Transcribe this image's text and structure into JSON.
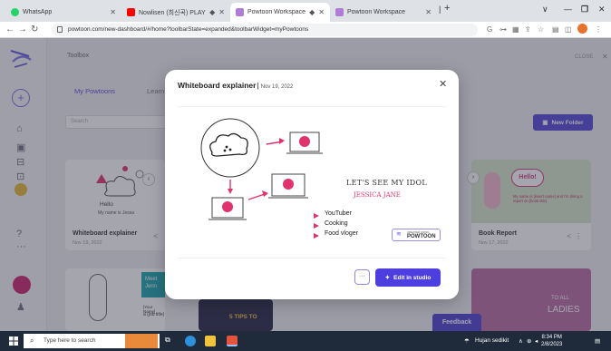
{
  "browser": {
    "tabs": [
      {
        "label": "WhatsApp",
        "icon": "whatsapp-icon",
        "color": "#25d366"
      },
      {
        "label": "Nowlisen (최신곡) PLAYLIST",
        "icon": "youtube-icon",
        "color": "#ff0000"
      },
      {
        "label": "Powtoon Workspace",
        "icon": "powtoon-icon",
        "color": "#b07cd8"
      },
      {
        "label": "Powtoon Workspace",
        "icon": "powtoon-icon",
        "color": "#b07cd8"
      }
    ],
    "new_tab": "+",
    "url": "powtoon.com/new-dashboard/#/home?toolbarState=expanded&toolbarWidget=myPowtoons"
  },
  "app": {
    "toolbox_label": "Toolbox",
    "close_label": "CLOSE",
    "tabs": [
      "My Powtoons",
      "Learn"
    ],
    "search_placeholder": "Search",
    "new_folder_label": "New Folder",
    "cards": [
      {
        "title": "Whiteboard explainer",
        "date": "Nov 19, 2022",
        "thumb_line1": "Hello",
        "thumb_line2": "My name is Jessa"
      },
      {
        "title": "Book Report",
        "date": "Nov 17, 2022",
        "thumb_line1": "Hello!",
        "thumb_line2": "My name is [insert name] and I'm doing a report on [book title]"
      }
    ],
    "bottom_thumbs": [
      {
        "line1": "Meet",
        "line2": "Jenn",
        "line3": "[Your Name]",
        "line4": "a (job title)"
      },
      {
        "line1": "5 TIPS TO"
      },
      {
        "line1": "TO ALL",
        "line2": "LADIES"
      }
    ],
    "feedback_label": "Feedback"
  },
  "modal": {
    "title": "Whiteboard explainer",
    "date": "Nov 19, 2022",
    "preview": {
      "heading": "LET'S SEE MY IDOL",
      "name": "JESSICA JANE",
      "bullets": [
        "YouTuber",
        "Cooking",
        "Food vloger"
      ],
      "brand_small": "CREATED USING",
      "brand": "POWTOON"
    },
    "edit_label": "Edit in studio",
    "more_label": "···"
  },
  "taskbar": {
    "search_placeholder": "Type here to search",
    "weather": "Hujan sedikit",
    "time": "8:34 PM",
    "date": "2/8/2023"
  },
  "colors": {
    "accent": "#5246d6",
    "taskbar": "#1f2b3b",
    "pink": "#e0326e"
  }
}
